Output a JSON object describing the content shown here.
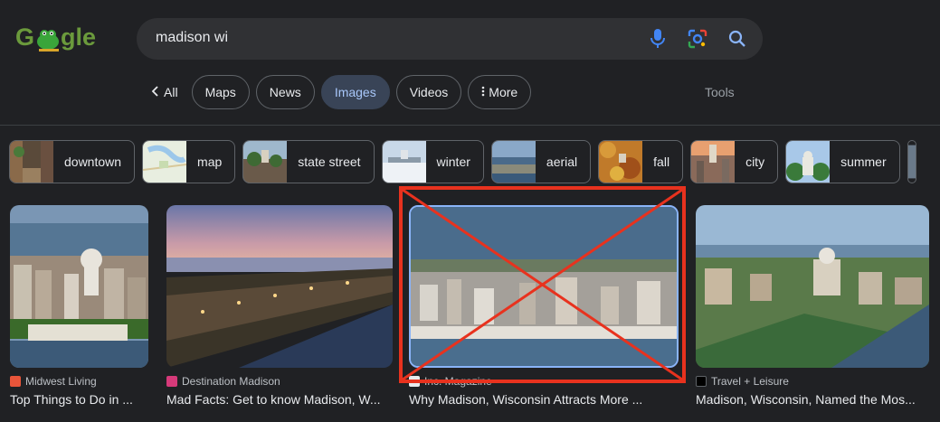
{
  "search": {
    "query": "madison wi"
  },
  "nav": {
    "all_label": "All",
    "tabs": [
      {
        "label": "Maps"
      },
      {
        "label": "News"
      },
      {
        "label": "Images",
        "active": true
      },
      {
        "label": "Videos"
      },
      {
        "label": "More"
      }
    ],
    "tools_label": "Tools"
  },
  "suggestions": [
    {
      "label": "downtown"
    },
    {
      "label": "map"
    },
    {
      "label": "state street"
    },
    {
      "label": "winter"
    },
    {
      "label": "aerial"
    },
    {
      "label": "fall"
    },
    {
      "label": "city"
    },
    {
      "label": "summer"
    }
  ],
  "results": [
    {
      "source": "Midwest Living",
      "title": "Top Things to Do in ..."
    },
    {
      "source": "Destination Madison",
      "title": "Mad Facts: Get to know Madison, W..."
    },
    {
      "source": "Inc. Magazine",
      "title": "Why Madison, Wisconsin Attracts More ..."
    },
    {
      "source": "Travel + Leisure",
      "title": "Madison, Wisconsin, Named the Mos..."
    }
  ],
  "colors": {
    "accent": "#a8c7fa",
    "annotation_red": "#e8321e"
  }
}
